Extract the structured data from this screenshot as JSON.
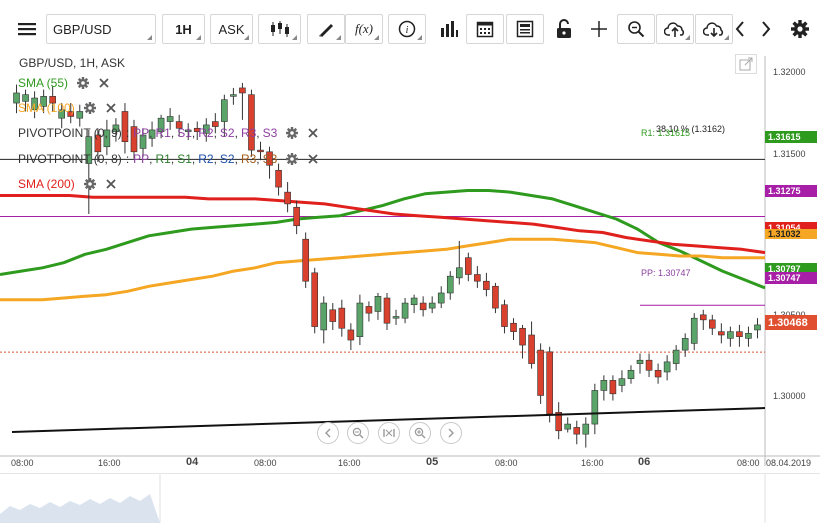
{
  "toolbar": {
    "symbol": "GBP/USD",
    "timeframe": "1H",
    "price_side": "ASK",
    "icons": [
      "hamburger-menu-icon",
      "candlestick-type-icon",
      "trend-line-icon",
      "function-icon",
      "info-icon",
      "bar-chart-icon",
      "calendar-icon",
      "news-icon",
      "lock-icon",
      "crosshair-icon",
      "zoom-icon",
      "upload-cloud-icon",
      "download-cloud-icon",
      "chevron-left-icon",
      "chevron-right-icon",
      "gear-icon"
    ]
  },
  "chart": {
    "header": "GBP/USD, 1H, ASK",
    "indicators": [
      {
        "label": "SMA (55)",
        "color": "#2e9a1e"
      },
      {
        "label": "SMA (100)",
        "color": "#f5a623"
      },
      {
        "label": "PIVOTPOINT (0, 9)",
        "levels": [
          "PP",
          "R1",
          "S1",
          "R2",
          "S2",
          "R3",
          "S3"
        ]
      },
      {
        "label": "PIVOTPOINT (0, 8)",
        "levels": [
          "PP",
          "R1",
          "S1",
          "R2",
          "S2",
          "R3",
          "S3"
        ]
      },
      {
        "label": "SMA (200)",
        "color": "#e0201c"
      }
    ],
    "annotations": {
      "fib": "38.10 % (1.3162)",
      "r1": "R1: 1.31615",
      "pp": "PP: 1.30747"
    },
    "price_labels": [
      "1.31615",
      "1.31275",
      "1.31054",
      "1.31032",
      "1.30797",
      "1.30747",
      "1.30468"
    ],
    "y_ticks": [
      "1.32000",
      "1.31500",
      "1.30500",
      "1.30000"
    ],
    "x_ticks": [
      "08:00",
      "16:00",
      "04",
      "08:00",
      "16:00",
      "05",
      "08:00",
      "16:00",
      "06",
      "08:00",
      "08.04.2019"
    ],
    "colors": {
      "up": "#5aa46a",
      "down": "#d9402e",
      "sma55": "#2e9a1e",
      "sma100": "#f5a623",
      "sma200": "#e0201c"
    }
  },
  "chart_data": {
    "type": "candlestick",
    "title": "GBP/USD, 1H, ASK",
    "ylim": [
      1.2985,
      1.3223
    ],
    "yticks": [
      1.32,
      1.315,
      1.305,
      1.3
    ],
    "series": [
      {
        "name": "SMA (55)",
        "values": [
          1.3093,
          1.3095,
          1.3097,
          1.31,
          1.3105,
          1.3108,
          1.3112,
          1.3116,
          1.3118,
          1.312,
          1.3121,
          1.3122,
          1.3123,
          1.3124,
          1.3126,
          1.3127,
          1.3128,
          1.3131,
          1.3134,
          1.3138,
          1.3141,
          1.3142,
          1.3143,
          1.3143,
          1.3142,
          1.314,
          1.3138,
          1.3134,
          1.313,
          1.3126,
          1.312,
          1.3112,
          1.3107,
          1.3101,
          1.3095,
          1.309,
          1.3085
        ]
      },
      {
        "name": "SMA (100)",
        "values": [
          1.3078,
          1.3078,
          1.3078,
          1.3079,
          1.308,
          1.3081,
          1.3083,
          1.3086,
          1.3088,
          1.309,
          1.3092,
          1.3095,
          1.3097,
          1.31,
          1.3101,
          1.3102,
          1.3103,
          1.3104,
          1.3105,
          1.3106,
          1.3107,
          1.3108,
          1.311,
          1.3112,
          1.3114,
          1.3114,
          1.3114,
          1.3113,
          1.3112,
          1.3109,
          1.3106,
          1.3105,
          1.3104,
          1.3104,
          1.3103,
          1.3103,
          1.3103
        ]
      },
      {
        "name": "SMA (200)",
        "values": [
          1.314,
          1.314,
          1.314,
          1.314,
          1.3139,
          1.3139,
          1.3139,
          1.3139,
          1.3139,
          1.3138,
          1.3138,
          1.3138,
          1.3137,
          1.3136,
          1.3135,
          1.3133,
          1.3131,
          1.3129,
          1.3128,
          1.3127,
          1.3126,
          1.3125,
          1.3124,
          1.3123,
          1.3121,
          1.3119,
          1.3118,
          1.3115,
          1.3113,
          1.3111,
          1.311,
          1.3109,
          1.3108,
          1.3106
        ]
      },
      {
        "name": "PIVOTPOINT R1",
        "values": [
          1.31615
        ]
      },
      {
        "name": "PIVOTPOINT PP",
        "values": [
          1.30747
        ]
      }
    ],
    "candles": [
      [
        1.3195,
        1.3201,
        1.3189,
        1.3206
      ],
      [
        1.3196,
        1.32,
        1.319,
        1.3203
      ],
      [
        1.3191,
        1.3198,
        1.3186,
        1.3202
      ],
      [
        1.3193,
        1.3199,
        1.3189,
        1.3203
      ],
      [
        1.3199,
        1.3195,
        1.319,
        1.3205
      ],
      [
        1.3186,
        1.3191,
        1.318,
        1.3195
      ],
      [
        1.319,
        1.3187,
        1.3183,
        1.3195
      ],
      [
        1.3186,
        1.319,
        1.3181,
        1.3194
      ],
      [
        1.3159,
        1.3175,
        1.3129,
        1.3179
      ],
      [
        1.3176,
        1.3166,
        1.316,
        1.318
      ],
      [
        1.3169,
        1.3179,
        1.3164,
        1.3185
      ],
      [
        1.3178,
        1.3182,
        1.3172,
        1.3186
      ],
      [
        1.319,
        1.3172,
        1.3165,
        1.3195
      ],
      [
        1.3181,
        1.3166,
        1.3162,
        1.3185
      ],
      [
        1.3168,
        1.3176,
        1.3163,
        1.318
      ],
      [
        1.3174,
        1.3179,
        1.3169,
        1.3184
      ],
      [
        1.3178,
        1.3186,
        1.3174,
        1.3188
      ],
      [
        1.3184,
        1.3187,
        1.3179,
        1.3192
      ],
      [
        1.3184,
        1.318,
        1.3175,
        1.3188
      ],
      [
        1.3178,
        1.3179,
        1.3173,
        1.3183
      ],
      [
        1.318,
        1.3178,
        1.3173,
        1.3184
      ],
      [
        1.3177,
        1.3182,
        1.3172,
        1.3186
      ],
      [
        1.3184,
        1.3181,
        1.3177,
        1.3189
      ],
      [
        1.3184,
        1.3197,
        1.3175,
        1.32
      ],
      [
        1.3199,
        1.32,
        1.3194,
        1.3204
      ],
      [
        1.3204,
        1.3201,
        1.3185,
        1.3207
      ],
      [
        1.32,
        1.3167,
        1.3163,
        1.3203
      ],
      [
        1.3167,
        1.3166,
        1.3161,
        1.3172
      ],
      [
        1.3166,
        1.3158,
        1.315,
        1.3169
      ],
      [
        1.3155,
        1.3145,
        1.314,
        1.3159
      ],
      [
        1.3142,
        1.3135,
        1.313,
        1.3148
      ],
      [
        1.3133,
        1.3122,
        1.3117,
        1.3137
      ],
      [
        1.3114,
        1.3089,
        1.3085,
        1.3118
      ],
      [
        1.3094,
        1.3062,
        1.3058,
        1.3097
      ],
      [
        1.306,
        1.3076,
        1.3052,
        1.308
      ],
      [
        1.3072,
        1.3065,
        1.306,
        1.3076
      ],
      [
        1.3073,
        1.3061,
        1.3056,
        1.3078
      ],
      [
        1.306,
        1.3054,
        1.3048,
        1.3064
      ],
      [
        1.3056,
        1.3076,
        1.3051,
        1.3081
      ],
      [
        1.3074,
        1.307,
        1.3065,
        1.3077
      ],
      [
        1.3071,
        1.308,
        1.3066,
        1.3082
      ],
      [
        1.3079,
        1.3064,
        1.306,
        1.3082
      ],
      [
        1.3067,
        1.3068,
        1.3063,
        1.3072
      ],
      [
        1.3067,
        1.3076,
        1.3064,
        1.3079
      ],
      [
        1.3075,
        1.3079,
        1.307,
        1.3081
      ],
      [
        1.3076,
        1.3072,
        1.3068,
        1.308
      ],
      [
        1.3073,
        1.3076,
        1.307,
        1.308
      ],
      [
        1.3076,
        1.3082,
        1.3073,
        1.3086
      ],
      [
        1.3082,
        1.3092,
        1.3078,
        1.3095
      ],
      [
        1.3091,
        1.3097,
        1.3087,
        1.3113
      ],
      [
        1.3103,
        1.3093,
        1.3089,
        1.3106
      ],
      [
        1.3093,
        1.3089,
        1.3085,
        1.3098
      ],
      [
        1.3089,
        1.3084,
        1.308,
        1.3094
      ],
      [
        1.3086,
        1.3073,
        1.307,
        1.3088
      ],
      [
        1.3075,
        1.3062,
        1.3058,
        1.3078
      ],
      [
        1.3064,
        1.3059,
        1.3054,
        1.3067
      ],
      [
        1.3061,
        1.3051,
        1.3043,
        1.3063
      ],
      [
        1.3057,
        1.304,
        1.3037,
        1.3065
      ],
      [
        1.3048,
        1.3021,
        1.3016,
        1.3052
      ],
      [
        1.3047,
        1.301,
        1.3005,
        1.305
      ],
      [
        1.3011,
        1.3,
        1.2995,
        1.3017
      ],
      [
        1.3001,
        1.3004,
        1.2999,
        1.3008
      ],
      [
        1.3002,
        1.2998,
        1.2992,
        1.3006
      ],
      [
        1.2998,
        1.3004,
        1.299,
        1.3008
      ],
      [
        1.3004,
        1.3024,
        1.2998,
        1.3028
      ],
      [
        1.3024,
        1.303,
        1.3018,
        1.3033
      ],
      [
        1.303,
        1.3022,
        1.3018,
        1.3033
      ],
      [
        1.3027,
        1.3031,
        1.3023,
        1.3036
      ],
      [
        1.3031,
        1.3036,
        1.3028,
        1.3039
      ],
      [
        1.304,
        1.3042,
        1.3034,
        1.3046
      ],
      [
        1.3042,
        1.3036,
        1.3032,
        1.3046
      ],
      [
        1.3036,
        1.3032,
        1.3028,
        1.304
      ],
      [
        1.3035,
        1.3041,
        1.303,
        1.3045
      ],
      [
        1.304,
        1.3048,
        1.3036,
        1.3051
      ],
      [
        1.3048,
        1.3055,
        1.3044,
        1.3058
      ],
      [
        1.3052,
        1.3067,
        1.3048,
        1.307
      ],
      [
        1.3069,
        1.3066,
        1.306,
        1.3072
      ],
      [
        1.3066,
        1.3061,
        1.3057,
        1.3069
      ],
      [
        1.3059,
        1.3057,
        1.3052,
        1.3064
      ],
      [
        1.3055,
        1.3059,
        1.305,
        1.3062
      ],
      [
        1.3059,
        1.3056,
        1.305,
        1.3063
      ],
      [
        1.3055,
        1.3058,
        1.305,
        1.3062
      ],
      [
        1.306,
        1.3063,
        1.3055,
        1.3067
      ]
    ]
  }
}
